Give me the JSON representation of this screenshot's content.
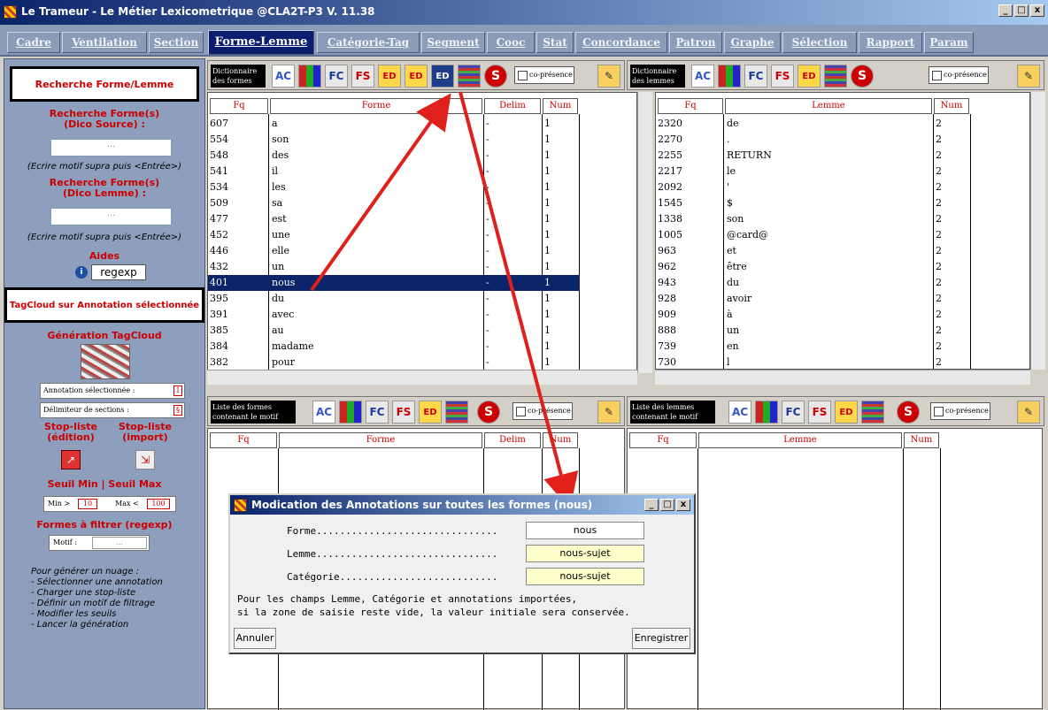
{
  "window": {
    "title": "Le Trameur - Le Métier Lexicometrique @CLA2T-P3 V. 11.38",
    "btn_min": "_",
    "btn_max": "□",
    "btn_close": "x"
  },
  "tabs": [
    "Cadre",
    "Ventilation",
    "Section",
    "Forme-Lemme",
    "Catégorie-Tag",
    "Segment",
    "Cooc",
    "Stat",
    "Concordance",
    "Patron",
    "Graphe",
    "Sélection",
    "Rapport",
    "Param"
  ],
  "sidebar": {
    "search_box": "Recherche Forme/Lemme",
    "search_forms_src": "Recherche Forme(s)\n(Dico Source) :",
    "input1": "...",
    "note1": "(Ecrire motif supra puis <Entrée>)",
    "search_forms_lemma": "Recherche Forme(s)\n(Dico Lemme) :",
    "input2": "...",
    "note2": "(Ecrire motif supra puis <Entrée>)",
    "aides": "Aides",
    "regexp": "regexp",
    "tagcloud_box": "TagCloud sur Annotation sélectionnée",
    "generation": "Génération TagCloud",
    "annot_label": "Annotation sélectionnée :",
    "annot_value": "1",
    "delim_label": "Délimiteur de sections :",
    "delim_value": "§",
    "stop_edit": "Stop-liste\n(édition)",
    "stop_import": "Stop-liste\n(import)",
    "seuil": "Seuil Min | Seuil Max",
    "min_label": "Min >",
    "min_value": "10",
    "max_label": "Max <",
    "max_value": "100",
    "filter": "Formes à filtrer (regexp)",
    "motif_label": "Motif :",
    "motif_value": "...",
    "instructions": [
      "Pour générer un nuage :",
      "- Sélectionner une annotation",
      "- Charger une stop-liste",
      "- Définir un motif de filtrage",
      "- Modifier les seuils",
      "- Lancer la génération"
    ]
  },
  "dico_formes": {
    "label": "Dictionnaire\ndes formes",
    "co_presence": "co-présence",
    "headers": [
      "Fq",
      "Forme",
      "Delim",
      "Num"
    ],
    "rows": [
      [
        "607",
        "a",
        "-",
        "1"
      ],
      [
        "554",
        "son",
        "-",
        "1"
      ],
      [
        "548",
        "des",
        "-",
        "1"
      ],
      [
        "541",
        "il",
        "-",
        "1"
      ],
      [
        "534",
        "les",
        "-",
        "1"
      ],
      [
        "509",
        "sa",
        "-",
        "1"
      ],
      [
        "477",
        "est",
        "-",
        "1"
      ],
      [
        "452",
        "une",
        "-",
        "1"
      ],
      [
        "446",
        "elle",
        "-",
        "1"
      ],
      [
        "432",
        "un",
        "-",
        "1"
      ],
      [
        "401",
        "nous",
        "-",
        "1"
      ],
      [
        "395",
        "du",
        "-",
        "1"
      ],
      [
        "391",
        "avec",
        "-",
        "1"
      ],
      [
        "385",
        "au",
        "-",
        "1"
      ],
      [
        "384",
        "madame",
        "-",
        "1"
      ],
      [
        "382",
        "pour",
        "-",
        "1"
      ]
    ]
  },
  "dico_lemmes": {
    "label": "Dictionnaire\ndes lemmes",
    "co_presence": "co-présence",
    "headers": [
      "Fq",
      "Lemme",
      "Num"
    ],
    "rows": [
      [
        "2320",
        "de",
        "2"
      ],
      [
        "2270",
        ".",
        "2"
      ],
      [
        "2255",
        "RETURN",
        "2"
      ],
      [
        "2217",
        "le",
        "2"
      ],
      [
        "2092",
        "'",
        "2"
      ],
      [
        "1545",
        "$",
        "2"
      ],
      [
        "1338",
        "son",
        "2"
      ],
      [
        "1005",
        "@card@",
        "2"
      ],
      [
        "963",
        "et",
        "2"
      ],
      [
        "962",
        "être",
        "2"
      ],
      [
        "943",
        "du",
        "2"
      ],
      [
        "928",
        "avoir",
        "2"
      ],
      [
        "909",
        "à",
        "2"
      ],
      [
        "888",
        "un",
        "2"
      ],
      [
        "739",
        "en",
        "2"
      ],
      [
        "730",
        "l",
        "2"
      ]
    ]
  },
  "liste_formes": {
    "label": "Liste des formes\ncontenant le motif",
    "co_presence": "co-présence",
    "headers": [
      "Fq",
      "Forme",
      "Delim",
      "Num"
    ]
  },
  "liste_lemmes": {
    "label": "Liste des lemmes\ncontenant le motif",
    "co_presence": "co-présence",
    "headers": [
      "Fq",
      "Lemme",
      "Num"
    ]
  },
  "toolbar_icons": [
    "AC",
    "chart",
    "FC",
    "FS",
    "ED",
    "ED",
    "ED",
    "grid",
    "S"
  ],
  "dialog": {
    "title": "Modication des Annotations sur toutes les formes (nous)",
    "forme_label": "Forme...............................",
    "forme_value": "nous",
    "lemme_label": "Lemme...............................",
    "lemme_value": "nous-sujet",
    "cat_label": "Catégorie...........................",
    "cat_value": "nous-sujet",
    "info1": "Pour les champs Lemme, Catégorie et annotations importées,",
    "info2": "si la zone de saisie reste vide, la valeur initiale sera conservée.",
    "cancel": "Annuler",
    "save": "Enregistrer"
  }
}
